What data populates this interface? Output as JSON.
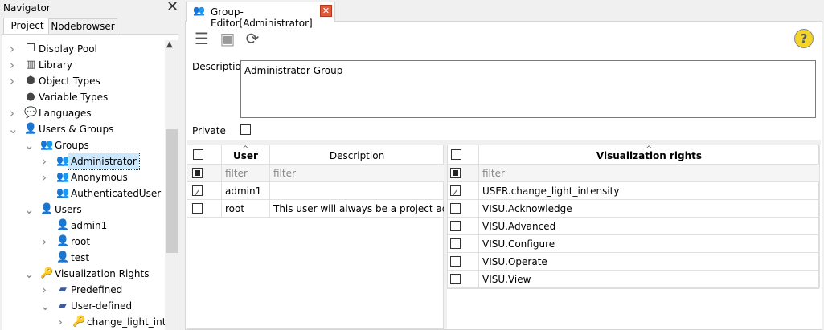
{
  "navigator": {
    "title": "Navigator",
    "tabs": [
      {
        "label": "Project",
        "active": true
      },
      {
        "label": "Nodebrowser",
        "active": false
      }
    ],
    "tree": [
      {
        "label": "Display Pool",
        "level": 0,
        "chevron": "collapsed",
        "icon": "display-pool-icon"
      },
      {
        "label": "Library",
        "level": 0,
        "chevron": "collapsed",
        "icon": "library-icon"
      },
      {
        "label": "Object Types",
        "level": 0,
        "chevron": "collapsed",
        "icon": "cube-icon"
      },
      {
        "label": "Variable Types",
        "level": 0,
        "chevron": "none",
        "icon": "circle-icon"
      },
      {
        "label": "Languages",
        "level": 0,
        "chevron": "collapsed",
        "icon": "languages-icon"
      },
      {
        "label": "Users & Groups",
        "level": 0,
        "chevron": "expanded",
        "icon": "user-icon"
      },
      {
        "label": "Groups",
        "level": 1,
        "chevron": "expanded",
        "icon": "group-icon"
      },
      {
        "label": "Administrator",
        "level": 2,
        "chevron": "collapsed",
        "icon": "group-icon",
        "selected": true
      },
      {
        "label": "Anonymous",
        "level": 2,
        "chevron": "collapsed",
        "icon": "group-icon"
      },
      {
        "label": "AuthenticatedUser",
        "level": 2,
        "chevron": "none",
        "icon": "group-icon"
      },
      {
        "label": "Users",
        "level": 1,
        "chevron": "expanded",
        "icon": "user-icon"
      },
      {
        "label": "admin1",
        "level": 2,
        "chevron": "none",
        "icon": "user-icon"
      },
      {
        "label": "root",
        "level": 2,
        "chevron": "collapsed",
        "icon": "user-icon"
      },
      {
        "label": "test",
        "level": 2,
        "chevron": "none",
        "icon": "user-icon"
      },
      {
        "label": "Visualization Rights",
        "level": 1,
        "chevron": "expanded",
        "icon": "key-icon"
      },
      {
        "label": "Predefined",
        "level": 2,
        "chevron": "collapsed",
        "icon": "folder-icon"
      },
      {
        "label": "User-defined",
        "level": 2,
        "chevron": "expanded",
        "icon": "folder-icon"
      },
      {
        "label": "change_light_inter",
        "level": 3,
        "chevron": "collapsed",
        "icon": "key-icon"
      }
    ]
  },
  "editor": {
    "tab_label": "Group-Editor[Administrator]",
    "description_label": "Description",
    "description_value": "Administrator-Group",
    "private_label": "Private",
    "private_checked": false,
    "users_table": {
      "headers": {
        "user": "User",
        "description": "Description"
      },
      "filter_placeholder": "filter",
      "rows": [
        {
          "checked": true,
          "user": "admin1",
          "description": ""
        },
        {
          "checked": false,
          "user": "root",
          "description": "This user will always be a project adminis"
        }
      ]
    },
    "rights_table": {
      "header": "Visualization rights",
      "filter_placeholder": "filter",
      "rows": [
        {
          "checked": true,
          "right": "USER.change_light_intensity"
        },
        {
          "checked": false,
          "right": "VISU.Acknowledge"
        },
        {
          "checked": false,
          "right": "VISU.Advanced"
        },
        {
          "checked": false,
          "right": "VISU.Configure"
        },
        {
          "checked": false,
          "right": "VISU.Operate"
        },
        {
          "checked": false,
          "right": "VISU.View"
        }
      ]
    }
  },
  "colors": {
    "selection": "#cce8ff",
    "help": "#f2d42a",
    "tab_close": "#e05a3a",
    "folder": "#3c5aa0"
  }
}
